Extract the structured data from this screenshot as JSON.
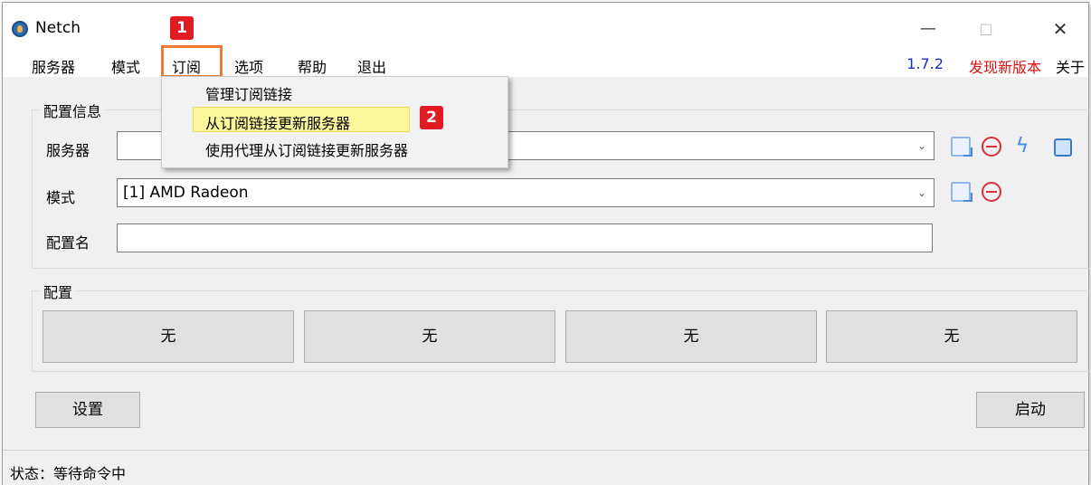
{
  "window": {
    "title": "Netch",
    "minimize": "—",
    "maximize": "□",
    "close": "✕"
  },
  "menubar": {
    "servers": "服务器",
    "mode": "模式",
    "subscription": "订阅",
    "options": "选项",
    "help": "帮助",
    "exit": "退出",
    "version": "1.7.2",
    "new_version": "发现新版本",
    "about": "关于"
  },
  "subscription_menu": {
    "items": [
      "管理订阅链接",
      "从订阅链接更新服务器",
      "使用代理从订阅链接更新服务器"
    ]
  },
  "annotations": {
    "badge1": "1",
    "badge2": "2"
  },
  "config_group": {
    "title": "配置信息",
    "server_label": "服务器",
    "server_value": "",
    "mode_label": "模式",
    "mode_value": "[1] AMD Radeon",
    "profile_name_label": "配置名",
    "profile_name_value": ""
  },
  "profile_group": {
    "title": "配置",
    "buttons": [
      "无",
      "无",
      "无",
      "无"
    ]
  },
  "buttons": {
    "settings": "设置",
    "start": "启动"
  },
  "status": {
    "text": "状态：等待命令中"
  },
  "icons": {
    "server_row": [
      "edit-icon",
      "remove-icon",
      "speed-test-icon",
      "copy-icon"
    ],
    "mode_row": [
      "edit-icon",
      "remove-icon"
    ]
  },
  "colors": {
    "version": "#1a2ecc",
    "new_version": "#e01010",
    "highlight_box": "#ee7a3a",
    "badge": "#e01b22",
    "menu_highlight": "#fbf79a"
  }
}
